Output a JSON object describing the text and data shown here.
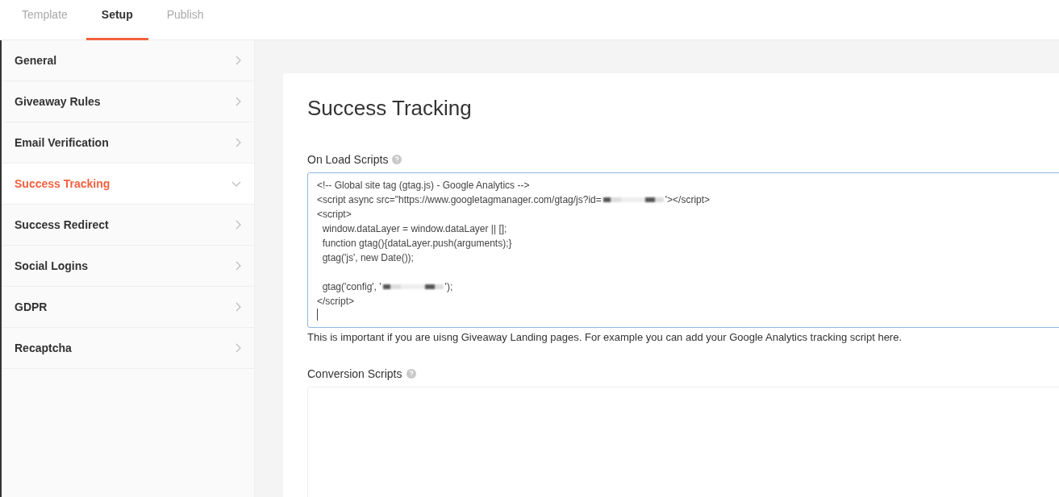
{
  "tabs": [
    {
      "label": "Template",
      "selected": false
    },
    {
      "label": "Setup",
      "selected": true
    },
    {
      "label": "Publish",
      "selected": false
    }
  ],
  "sidebar": {
    "items": [
      {
        "label": "General",
        "expanded": false
      },
      {
        "label": "Giveaway Rules",
        "expanded": false
      },
      {
        "label": "Email Verification",
        "expanded": false
      },
      {
        "label": "Success Tracking",
        "expanded": true
      },
      {
        "label": "Success Redirect",
        "expanded": false
      },
      {
        "label": "Social Logins",
        "expanded": false
      },
      {
        "label": "GDPR",
        "expanded": false
      },
      {
        "label": "Recaptcha",
        "expanded": false
      }
    ]
  },
  "panel": {
    "title": "Success Tracking",
    "on_load_scripts": {
      "label": "On Load Scripts",
      "blocks": [
        [
          {
            "text": "<!-- Global site tag (gtag.js) - Google Analytics -->"
          },
          {
            "text": "<script async src=\"https://www.googletagmanager.com/gtag/js?id=",
            "redacted": true,
            "after": "'></script>"
          },
          {
            "text": "<script>"
          },
          {
            "text": "  window.dataLayer = window.dataLayer || [];"
          },
          {
            "text": "  function gtag(){dataLayer.push(arguments);}"
          },
          {
            "text": "  gtag('js', new Date());"
          }
        ],
        [
          {
            "text": "  gtag('config', '",
            "redacted": true,
            "after": "');"
          },
          {
            "text": "</script>"
          }
        ]
      ],
      "focused": true,
      "help": "This is important if you are uisng Giveaway Landing pages. For example you can add your Google Analytics tracking script here."
    },
    "conversion_scripts": {
      "label": "Conversion Scripts",
      "focused": false
    }
  }
}
